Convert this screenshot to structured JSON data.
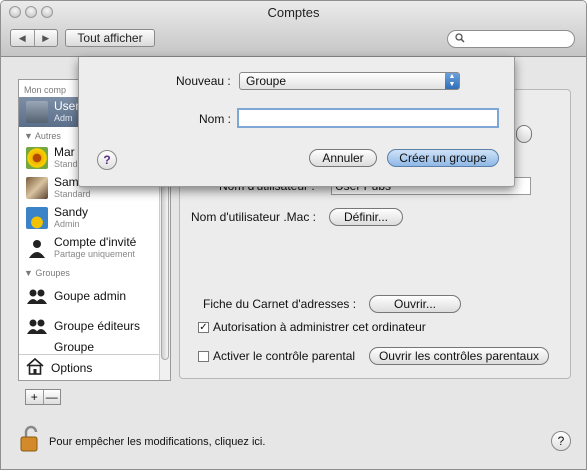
{
  "window": {
    "title": "Comptes"
  },
  "toolbar": {
    "back_label": "◀",
    "forward_label": "▶",
    "show_all_label": "Tout afficher",
    "search_placeholder": ""
  },
  "sidebar": {
    "header_my_account": "Mon comp",
    "current_user": {
      "name": "User",
      "role": "Adm"
    },
    "header_other": "▼ Autres",
    "items": [
      {
        "name": "Mar",
        "role": "Stand"
      },
      {
        "name": "Sam",
        "role": "Standard"
      },
      {
        "name": "Sandy",
        "role": "Admin"
      },
      {
        "name": "Compte d'invité",
        "role": "Partage uniquement"
      }
    ],
    "header_groups": "▼ Groupes",
    "groups": [
      {
        "name": "Goupe admin"
      },
      {
        "name": "Groupe éditeurs"
      },
      {
        "name": "Groupe"
      }
    ],
    "options_label": "Options",
    "plus_label": "+",
    "minus_label": "—"
  },
  "main": {
    "username_label": "Nom d'utilisateur :",
    "username_value": "User Pubs",
    "mac_label": "Nom d'utilisateur .Mac :",
    "mac_button": "Définir...",
    "address_label": "Fiche du Carnet d'adresses :",
    "address_button": "Ouvrir...",
    "admin_checkbox_label": "Autorisation à administrer cet ordinateur",
    "admin_checked": true,
    "parental_checkbox_label": "Activer le contrôle parental",
    "parental_checked": false,
    "parental_button": "Ouvrir les contrôles parentaux"
  },
  "sheet": {
    "new_label": "Nouveau :",
    "new_value": "Groupe",
    "name_label": "Nom :",
    "name_value": "",
    "help_label": "?",
    "cancel_button": "Annuler",
    "create_button": "Créer un groupe"
  },
  "footer": {
    "lock_text": "Pour empêcher les modifications, cliquez ici.",
    "help_label": "?"
  },
  "colors": {
    "selection": "#6a7e98",
    "default_button": "#8fb8e6",
    "help_purple": "#5b2d8a"
  }
}
